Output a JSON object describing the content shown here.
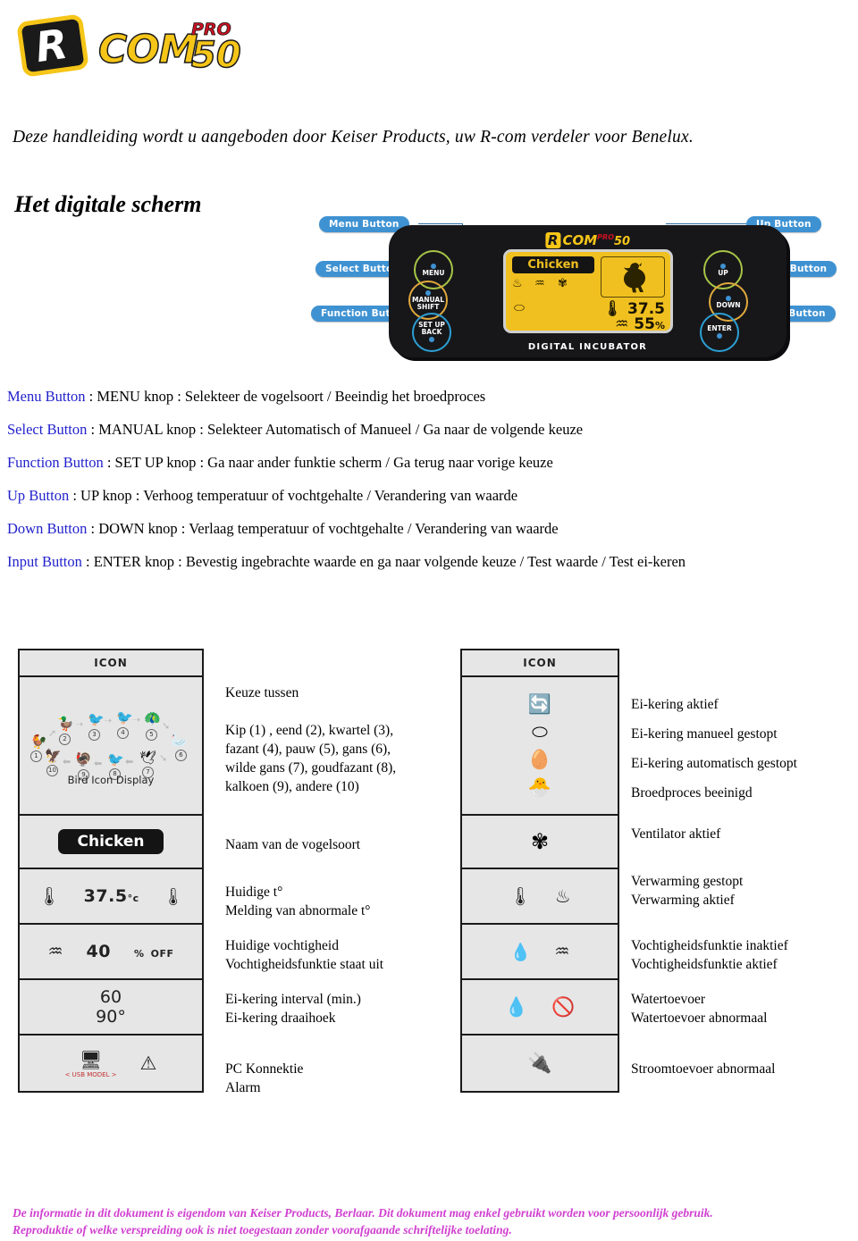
{
  "logo": {
    "letter": "R",
    "com": "COM",
    "pro": "PRO",
    "fifty": "50"
  },
  "intro_line": "Deze handleiding wordt u aangeboden door Keiser Products,  uw R-com verdeler voor Benelux.",
  "section_title": "Het  digitale scherm",
  "device": {
    "brand_r": "R",
    "brand_com": "COM",
    "brand_pro": "PRO",
    "brand_50": "50",
    "footer_label": "DIGITAL INCUBATOR",
    "callouts": {
      "menu": "Menu Button",
      "select": "Select Button",
      "function": "Function Button",
      "up": "Up Button",
      "down": "Down Button",
      "input": "Input Button"
    },
    "buttons": {
      "menu": "MENU",
      "manual_l1": "MANUAL",
      "manual_l2": "SHIFT",
      "setup_l1": "SET UP",
      "setup_l2": "BACK",
      "up": "UP",
      "down": "DOWN",
      "enter": "ENTER"
    },
    "lcd": {
      "species": "Chicken",
      "temperature": "37.5",
      "humidity": "55",
      "humidity_unit": "%"
    }
  },
  "button_list": [
    {
      "label": "Menu Button",
      "text": " : MENU knop : Selekteer de vogelsoort  /  Beeindig het broedproces"
    },
    {
      "label": "Select Button",
      "text": " : MANUAL knop : Selekteer Automatisch of Manueel / Ga naar de volgende keuze"
    },
    {
      "label": "Function Button",
      "text": " : SET UP knop : Ga naar ander funktie scherm / Ga terug naar vorige keuze"
    },
    {
      "label": "Up Button",
      "text": " :  UP knop : Verhoog temperatuur of vochtgehalte / Verandering van waarde"
    },
    {
      "label": "Down Button",
      "text": " :  DOWN knop : Verlaag temperatuur of vochtgehalte / Verandering van waarde"
    },
    {
      "label": "Input Button",
      "text": " : ENTER knop : Bevestig ingebrachte waarde en ga naar volgende keuze / Test waarde / Test ei-keren"
    }
  ],
  "table_left": {
    "header": "ICON",
    "bird_caption": "Bird Icon Display",
    "bird_numbers": [
      "1",
      "2",
      "3",
      "4",
      "5",
      "6",
      "7",
      "8",
      "9",
      "10"
    ],
    "species_badge": "Chicken",
    "temperature_value": "37.5",
    "temperature_unit": "°c",
    "humidity_value": "40",
    "humidity_unit": "%",
    "humidity_state": "OFF",
    "turn_interval": "60",
    "turn_angle": "90°",
    "usb_label": "< USB MODEL >",
    "descriptions": [
      {
        "lines": [
          "Keuze tussen",
          "",
          "Kip (1) , eend (2), kwartel (3),",
          "fazant (4), pauw (5), gans (6),",
          "wilde gans (7), goudfazant (8),",
          "kalkoen (9), andere (10)"
        ]
      },
      {
        "lines": [
          "Naam van de vogelsoort"
        ]
      },
      {
        "lines": [
          "Huidige t°",
          "Melding van abnormale t°"
        ]
      },
      {
        "lines": [
          "Huidige vochtigheid",
          "Vochtigheidsfunktie staat uit"
        ]
      },
      {
        "lines": [
          "Ei-kering interval (min.)",
          "Ei-kering draaihoek"
        ]
      },
      {
        "lines": [
          "PC Konnektie",
          "Alarm"
        ]
      }
    ]
  },
  "table_right": {
    "header": "ICON",
    "descriptions": [
      {
        "lines": [
          "Ei-kering aktief",
          "Ei-kering manueel gestopt",
          "Ei-kering automatisch gestopt",
          "Broedproces beeinigd"
        ]
      },
      {
        "lines": [
          "Ventilator aktief"
        ]
      },
      {
        "lines": [
          "Verwarming gestopt",
          "Verwarming aktief"
        ]
      },
      {
        "lines": [
          "Vochtigheidsfunktie inaktief",
          "Vochtigheidsfunktie aktief"
        ]
      },
      {
        "lines": [
          "Watertoevoer",
          "Watertoevoer abnormaal"
        ]
      },
      {
        "lines": [
          "Stroomtoevoer abnormaal"
        ]
      }
    ]
  },
  "footer": {
    "line1": "De informatie in dit dokument is eigendom van Keiser Products, Berlaar.  Dit dokument mag enkel gebruikt worden voor persoonlijk gebruik.",
    "line2": "Reproduktie of welke verspreiding ook is niet toegestaan zonder voorafgaande schriftelijke toelating."
  },
  "colors": {
    "label_blue": "#2222cc",
    "callout_blue": "#3f92d2",
    "brand_yellow": "#f5c518",
    "brand_red": "#cc1122",
    "footer_magenta": "#d03fd0",
    "lcd_amber": "#f0c020"
  }
}
